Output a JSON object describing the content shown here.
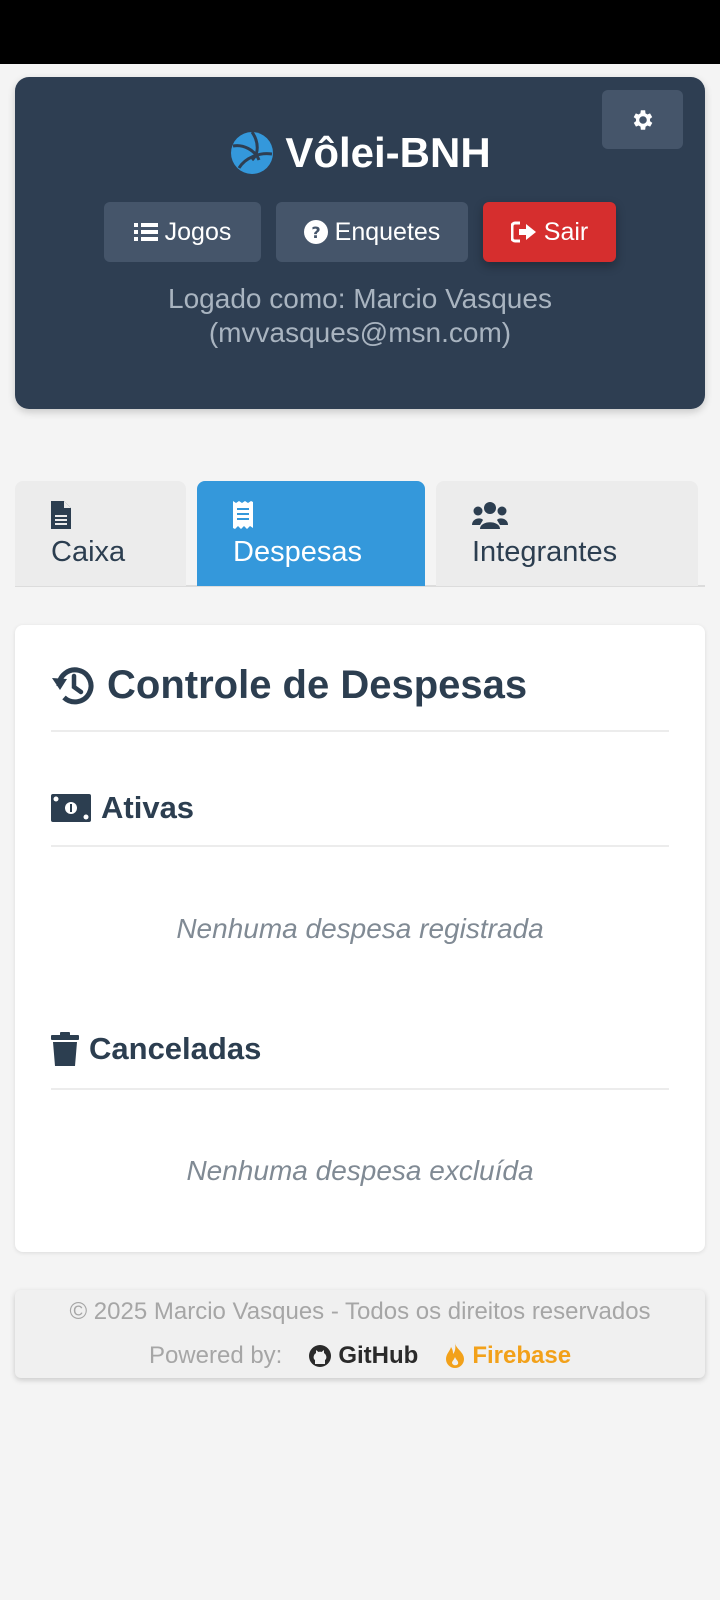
{
  "header": {
    "title": "Vôlei-BNH",
    "nav": [
      {
        "label": "Jogos",
        "icon": "list-icon"
      },
      {
        "label": "Enquetes",
        "icon": "question-circle-icon"
      },
      {
        "label": "Sair",
        "icon": "sign-out-icon"
      }
    ],
    "logged_line1": "Logado como: Marcio Vasques",
    "logged_line2": "(mvvasques@msn.com)"
  },
  "tabs": [
    {
      "label": "Caixa",
      "icon": "file-icon",
      "active": false
    },
    {
      "label": "Despesas",
      "icon": "receipt-icon",
      "active": true
    },
    {
      "label": "Integrantes",
      "icon": "users-icon",
      "active": false
    }
  ],
  "card": {
    "title": "Controle de Despesas",
    "sections": [
      {
        "title": "Ativas",
        "icon": "money-icon",
        "empty_text": "Nenhuma despesa registrada"
      },
      {
        "title": "Canceladas",
        "icon": "trash-icon",
        "empty_text": "Nenhuma despesa excluída"
      }
    ]
  },
  "footer": {
    "copyright": "© 2025 Marcio Vasques - Todos os direitos reservados",
    "powered_label": "Powered by:",
    "brands": [
      "GitHub",
      "Firebase"
    ]
  },
  "colors": {
    "header_bg": "#2e3e52",
    "button_bg": "#45556a",
    "danger": "#d62e2e",
    "active_tab": "#3498db",
    "text_dark": "#2c3e50",
    "firebase": "#f2a11a"
  }
}
